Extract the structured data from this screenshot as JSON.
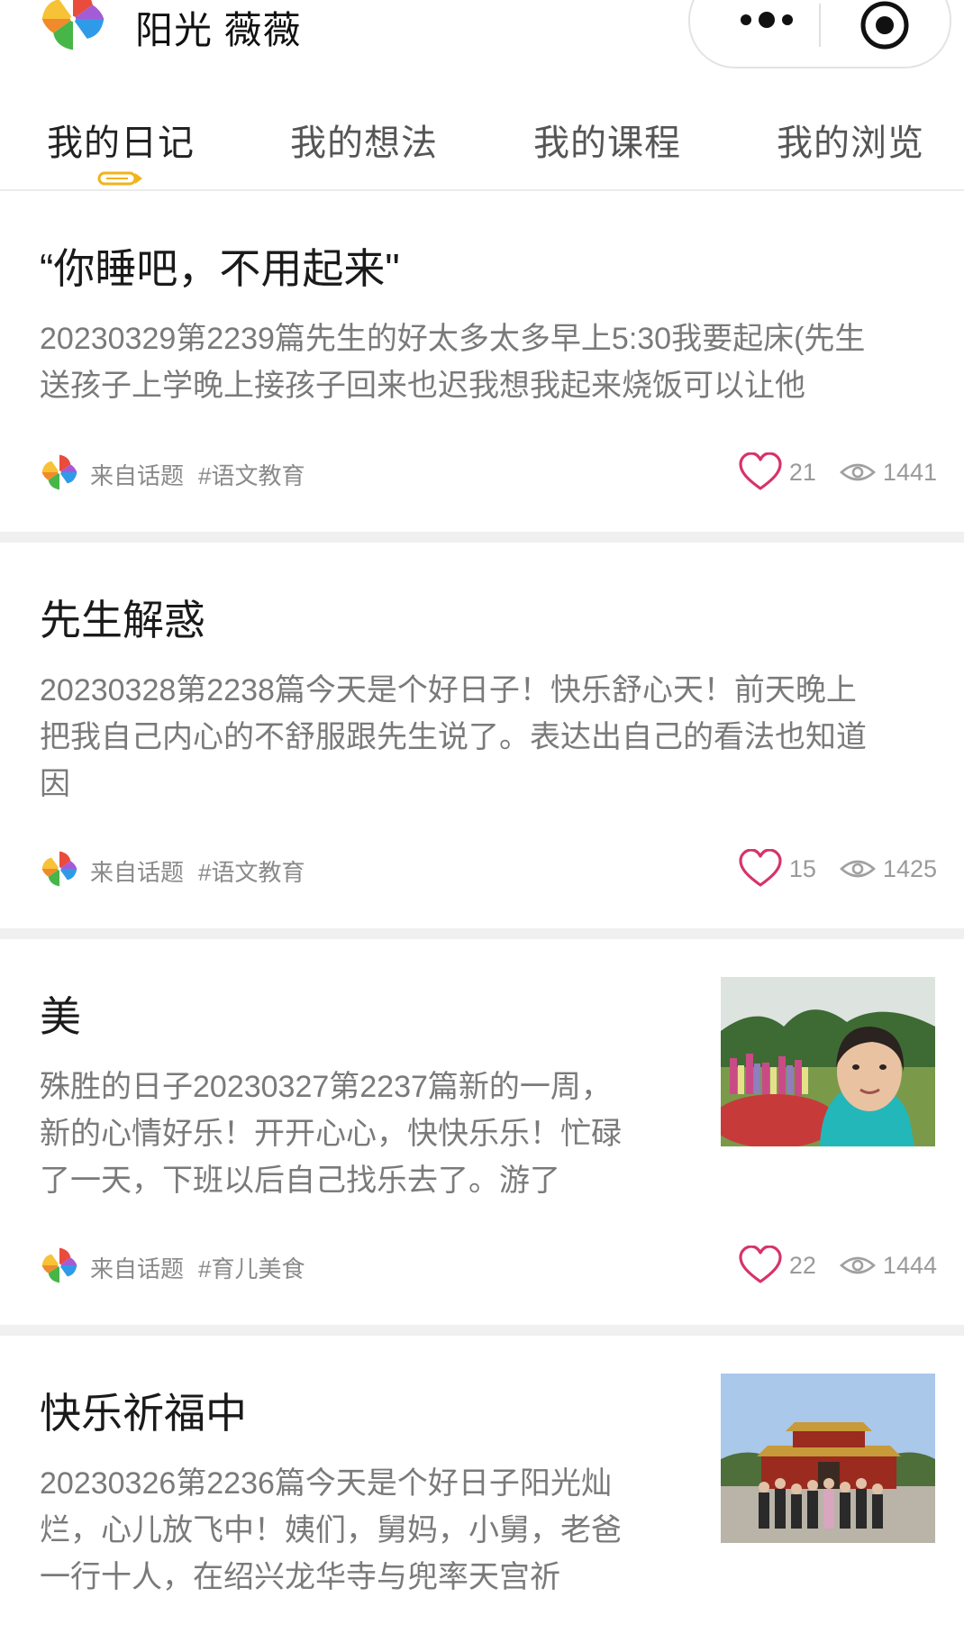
{
  "header": {
    "user_name": "阳光 薇薇"
  },
  "tabs": [
    {
      "label": "我的日记",
      "active": true
    },
    {
      "label": "我的想法",
      "active": false
    },
    {
      "label": "我的课程",
      "active": false
    },
    {
      "label": "我的浏览",
      "active": false
    }
  ],
  "posts": [
    {
      "title": "“你睡吧，不用起来\"",
      "body": [
        "20230329第2239篇先生的好太多太多早上5:30我要起床(先生",
        "送孩子上学晚上接孩子回来也迟我想我起来烧饭可以让他"
      ],
      "from": "来自话题",
      "tag": "#语文教育",
      "likes": "21",
      "views": "1441"
    },
    {
      "title": "先生解惑",
      "body": [
        "20230328第2238篇今天是个好日子！快乐舒心天！前天晚上",
        "把我自己内心的不舒服跟先生说了。表达出自己的看法也知道",
        "因"
      ],
      "from": "来自话题",
      "tag": "#语文教育",
      "likes": "15",
      "views": "1425"
    },
    {
      "title": "美",
      "body": [
        "殊胜的日子20230327第2237篇新的一周，",
        "新的心情好乐！开开心心，快快乐乐！忙碌",
        "了一天，下班以后自己找乐去了。游了"
      ],
      "from": "来自话题",
      "tag": "#育儿美食",
      "likes": "22",
      "views": "1444"
    },
    {
      "title": "快乐祈福中",
      "body": [
        "20230326第2236篇今天是个好日子阳光灿",
        "烂，心儿放飞中！姨们，舅妈，小舅，老爸",
        "一行十人，在绍兴龙华寺与兜率天宫祈"
      ]
    }
  ],
  "icons": {
    "logo": "pinwheel-logo-icon",
    "more": "more-dots-icon",
    "close": "target-circle-icon",
    "like": "heart-icon",
    "view": "eye-icon"
  },
  "colors": {
    "heart": "#d6336c",
    "indicator": "#f2b31b",
    "meta_text": "#8a8a8a",
    "body_text": "#7a7a7a"
  }
}
